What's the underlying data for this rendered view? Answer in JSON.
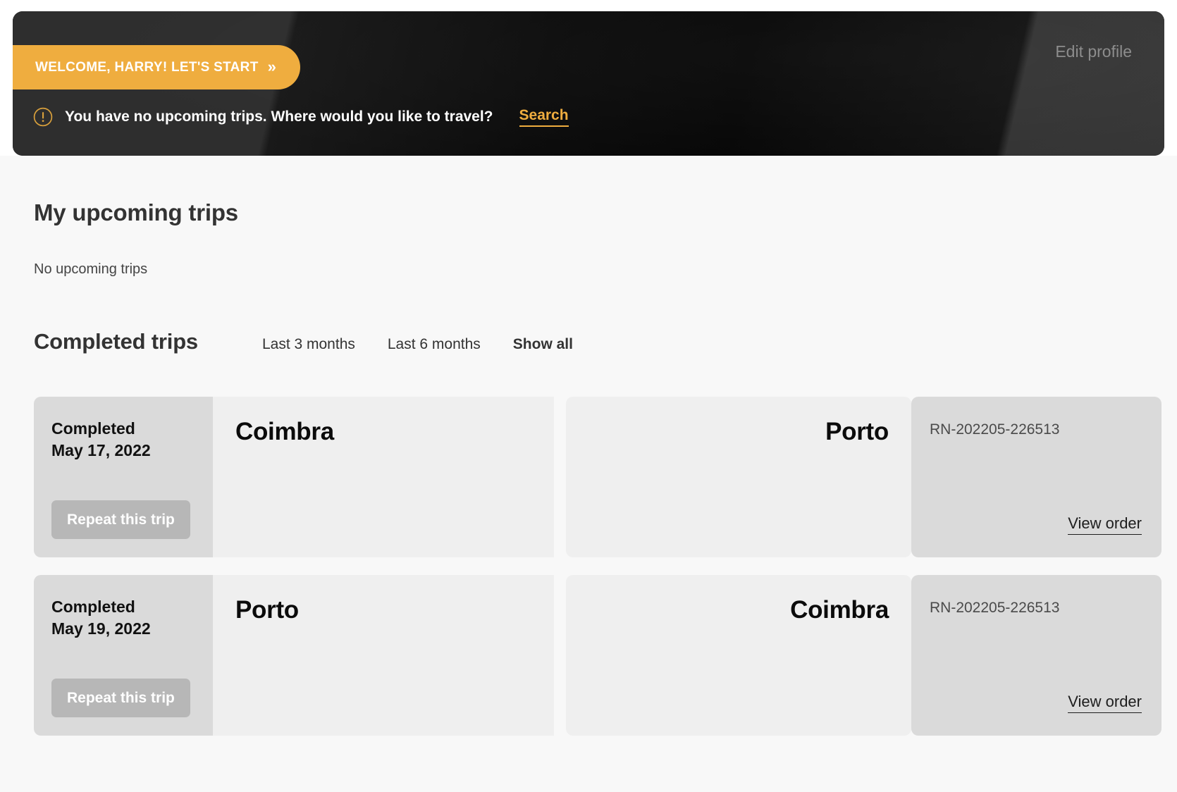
{
  "hero": {
    "welcome_button_label": "WELCOME, HARRY! LET'S START",
    "welcome_button_chevron": "»",
    "edit_profile_label": "Edit profile",
    "alert_icon": "exclamation-circle-icon",
    "alert_message": "You have no upcoming trips. Where would you like to travel?",
    "search_link_label": "Search",
    "accent_color": "#efad3f",
    "banner_background_color": "#111111"
  },
  "upcoming": {
    "heading": "My upcoming trips",
    "empty_message": "No upcoming trips"
  },
  "completed": {
    "heading": "Completed trips",
    "filters": [
      {
        "label": "Last 3 months",
        "active": false
      },
      {
        "label": "Last 6 months",
        "active": false
      },
      {
        "label": "Show all",
        "active": true
      }
    ],
    "trips": [
      {
        "status": "Completed",
        "date": "May 17, 2022",
        "repeat_label": "Repeat this trip",
        "origin": "Coimbra",
        "destination": "Porto",
        "order_number": "RN-202205-226513",
        "view_order_label": "View order"
      },
      {
        "status": "Completed",
        "date": "May 19, 2022",
        "repeat_label": "Repeat this trip",
        "origin": "Porto",
        "destination": "Coimbra",
        "order_number": "RN-202205-226513",
        "view_order_label": "View order"
      }
    ]
  }
}
